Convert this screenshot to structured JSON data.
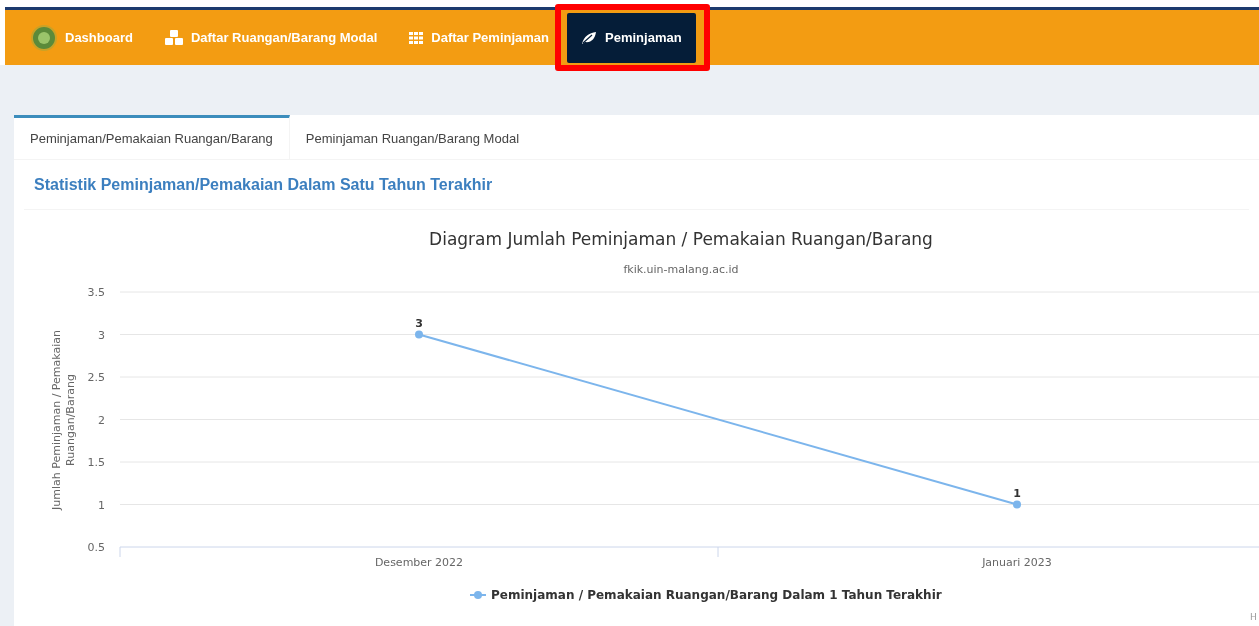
{
  "navbar": {
    "items": [
      {
        "label": "Dashboard",
        "kind": "logo",
        "selected": false,
        "highlighted": false
      },
      {
        "label": "Daftar Ruangan/Barang Modal",
        "kind": "cubes",
        "selected": false,
        "highlighted": false
      },
      {
        "label": "Daftar Peminjaman",
        "kind": "grid",
        "selected": false,
        "highlighted": false
      },
      {
        "label": "Peminjaman",
        "kind": "leaf",
        "selected": true,
        "highlighted": true
      }
    ]
  },
  "tabs": [
    {
      "label": "Peminjaman/Pemakaian Ruangan/Barang",
      "selected": true
    },
    {
      "label": "Peminjaman Ruangan/Barang Modal",
      "selected": false
    }
  ],
  "section_title": "Statistik Peminjaman/Pemakaian Dalam Satu Tahun Terakhir",
  "chart": {
    "credit": "H",
    "chart_data": {
      "type": "line",
      "title": "Diagram Jumlah Peminjaman / Pemakaian Ruangan/Barang",
      "subtitle": "fkik.uin-malang.ac.id",
      "ylabel": "Jumlah Peminjaman / Pemakaian Ruangan/Barang",
      "categories": [
        "Desember 2022",
        "Januari 2023"
      ],
      "yticks": [
        0.5,
        1,
        1.5,
        2,
        2.5,
        3,
        3.5
      ],
      "ylim": [
        0.5,
        3.5
      ],
      "data_labels": true,
      "grid": true,
      "series": [
        {
          "name": "Peminjaman / Pemakaian Ruangan/Barang Dalam 1 Tahun Terakhir",
          "color": "#7cb5ec",
          "marker": true,
          "values": [
            3,
            1
          ]
        }
      ]
    }
  }
}
